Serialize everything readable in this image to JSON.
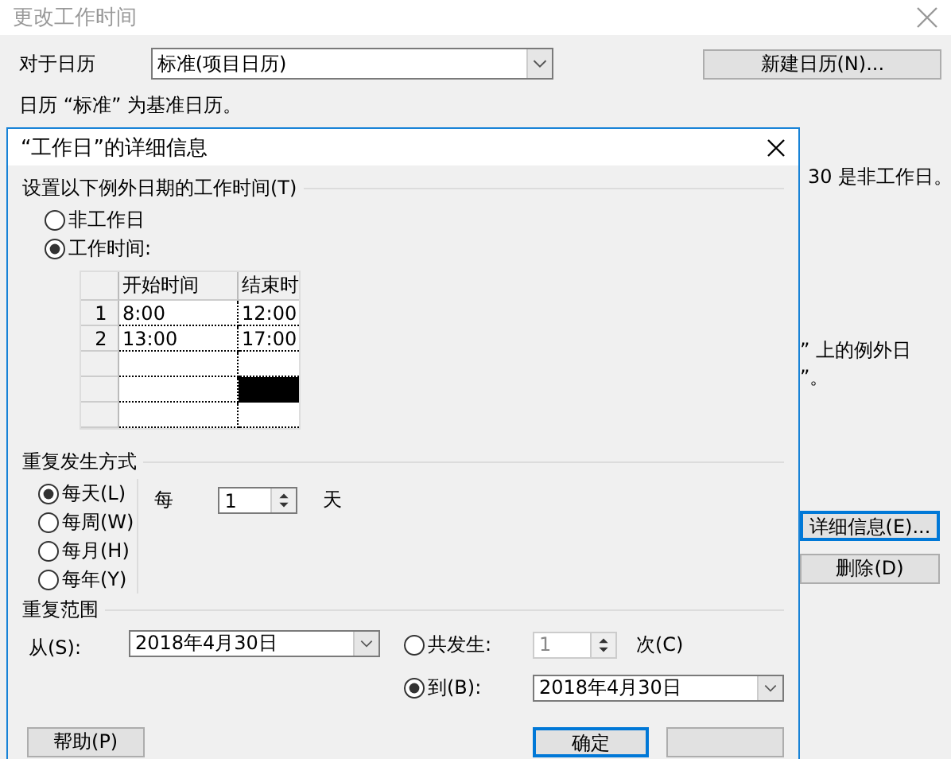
{
  "background_window": {
    "title": "更改工作时间",
    "calendar_label": "对于日历",
    "calendar_value": "标准(项目日历)",
    "new_calendar_button": "新建日历(N)...",
    "base_note": "日历 “标准” 为基准日历。",
    "partial_texts": [
      "30 是非工作日。",
      "” 上的例外日",
      "”。"
    ],
    "buttons": [
      {
        "label": "详细信息(E)...",
        "focused": true
      },
      {
        "label": "删除(D)",
        "focused": false
      }
    ]
  },
  "dialog": {
    "title": "“工作日”的详细信息",
    "hours": {
      "title": "设置以下例外日期的工作时间(T)",
      "options": [
        {
          "label": "非工作日",
          "selected": false
        },
        {
          "label": "工作时间:",
          "selected": true
        }
      ],
      "columns": [
        "开始时间",
        "结束时"
      ],
      "rows": [
        {
          "number": "1",
          "start": "8:00",
          "end": "12:00",
          "end_selected": false
        },
        {
          "number": "2",
          "start": "13:00",
          "end": "17:00",
          "end_selected": false
        },
        {
          "end_selected": false
        },
        {
          "end_selected": true
        },
        {
          "end_selected": false
        }
      ]
    },
    "recurrence": {
      "title": "重复发生方式",
      "options": [
        {
          "label": "每天(L)",
          "selected": true
        },
        {
          "label": "每周(W)",
          "selected": false
        },
        {
          "label": "每月(H)",
          "selected": false
        },
        {
          "label": "每年(Y)",
          "selected": false
        }
      ],
      "every_label": "每",
      "every_value": "1",
      "unit": "天"
    },
    "range": {
      "title": "重复范围",
      "from_label": "从(S):",
      "from_value": "2018年4月30日",
      "occurrences": {
        "label": "共发生:",
        "selected": false,
        "value": "1",
        "unit": "次(C)"
      },
      "end_by": {
        "label": "到(B):",
        "selected": true,
        "value": "2018年4月30日"
      }
    },
    "buttons": [
      {
        "label": "帮助(P)",
        "focused": false
      },
      {
        "label": "确定",
        "focused": true
      },
      {
        "focused": false
      }
    ]
  }
}
